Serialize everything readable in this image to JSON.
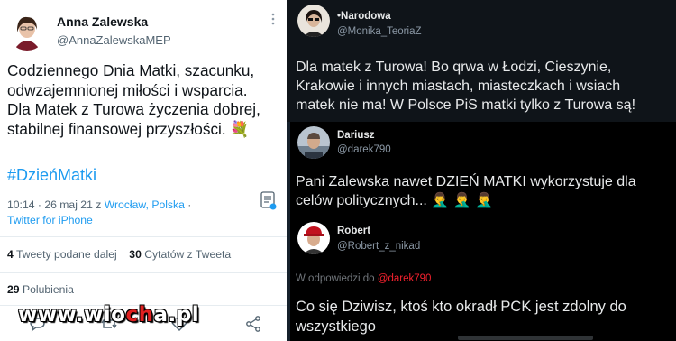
{
  "left_tweet": {
    "author_name": "Anna Zalewska",
    "author_handle": "@AnnaZalewskaMEP",
    "more_glyph": "⋮",
    "text_lines": [
      "Codziennego Dnia Matki, szacunku,",
      "odwzajemnionej miłości i wsparcia.",
      "Dla Matek z Turowa życzenia dobrej,",
      "stabilnej finansowej przyszłości. 💐"
    ],
    "hashtag": "#DzieńMatki",
    "time": "10:14 · 26 maj 21 z ",
    "location": "Wrocław, Polska",
    "location_sep": " · ",
    "client": "Twitter for iPhone",
    "retweets_count": "4",
    "retweets_label": " Tweety podane dalej",
    "quotes_count": "30",
    "quotes_label": " Cytatów z Tweeta",
    "likes_count": "29",
    "likes_label": " Polubienia",
    "icons": [
      "translate-icon",
      "reply-icon",
      "retweet-icon",
      "like-icon",
      "share-icon"
    ]
  },
  "right_tweets": [
    {
      "author_name": "•Narodowa",
      "author_handle": "@Monika_TeoriaZ",
      "text_lines": [
        "Dla matek z Turowa! Bo qrwa w Łodzi, Cieszynie,",
        "Krakowie i innych miastach, miasteczkach i wsiach",
        "matek nie ma! W Polsce PiS matki tylko z Turowa są!"
      ]
    },
    {
      "author_name": "Dariusz",
      "author_handle": "@darek790",
      "text_lines": [
        "Pani Zalewska nawet DZIEŃ MATKI wykorzystuje dla",
        "celów politycznych... 🤦‍♂️ 🤦‍♂️ 🤦‍♂️"
      ]
    },
    {
      "author_name": "Robert",
      "author_handle": "@Robert_z_nikad",
      "reply_prefix": "W odpowiedzi do ",
      "reply_mention": "@darek790",
      "text_lines": [
        "Co się Dziwisz, ktoś kto okradł PCK jest zdolny do",
        "wszystkiego"
      ]
    }
  ],
  "watermark": {
    "part1": "www.wio",
    "part2": "ch",
    "part3": "a.pl"
  },
  "colors": {
    "link_blue": "#1d9bf0",
    "dark_bg": "#000000",
    "light_bg": "#ffffff",
    "mention_red": "#f4212e"
  }
}
